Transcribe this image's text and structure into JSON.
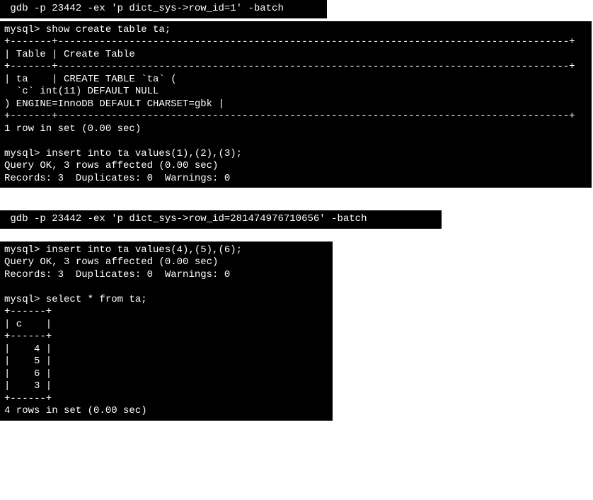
{
  "block1": {
    "gdb_line": " gdb -p 23442 -ex 'p dict_sys->row_id=1' -batch"
  },
  "block2": {
    "l01": "mysql> show create table ta;",
    "l02": "+-------+--------------------------------------------------------------------------------------+",
    "l03": "| Table | Create Table",
    "l04": "+-------+--------------------------------------------------------------------------------------+",
    "l05": "| ta    | CREATE TABLE `ta` (",
    "l06": "  `c` int(11) DEFAULT NULL",
    "l07": ") ENGINE=InnoDB DEFAULT CHARSET=gbk |",
    "l08": "+-------+--------------------------------------------------------------------------------------+",
    "l09": "1 row in set (0.00 sec)",
    "l10": "",
    "l11": "mysql> insert into ta values(1),(2),(3);",
    "l12": "Query OK, 3 rows affected (0.00 sec)",
    "l13": "Records: 3  Duplicates: 0  Warnings: 0"
  },
  "block3": {
    "gdb_line": " gdb -p 23442 -ex 'p dict_sys->row_id=281474976710656' -batch"
  },
  "block4": {
    "l01": "mysql> insert into ta values(4),(5),(6);",
    "l02": "Query OK, 3 rows affected (0.00 sec)",
    "l03": "Records: 3  Duplicates: 0  Warnings: 0",
    "l04": "",
    "l05": "mysql> select * from ta;",
    "l06": "+------+",
    "l07": "| c    |",
    "l08": "+------+",
    "l09": "|    4 |",
    "l10": "|    5 |",
    "l11": "|    6 |",
    "l12": "|    3 |",
    "l13": "+------+",
    "l14": "4 rows in set (0.00 sec)"
  },
  "chart_data": {
    "type": "table",
    "title": "select * from ta",
    "columns": [
      "c"
    ],
    "rows": [
      [
        4
      ],
      [
        5
      ],
      [
        6
      ],
      [
        3
      ]
    ]
  }
}
